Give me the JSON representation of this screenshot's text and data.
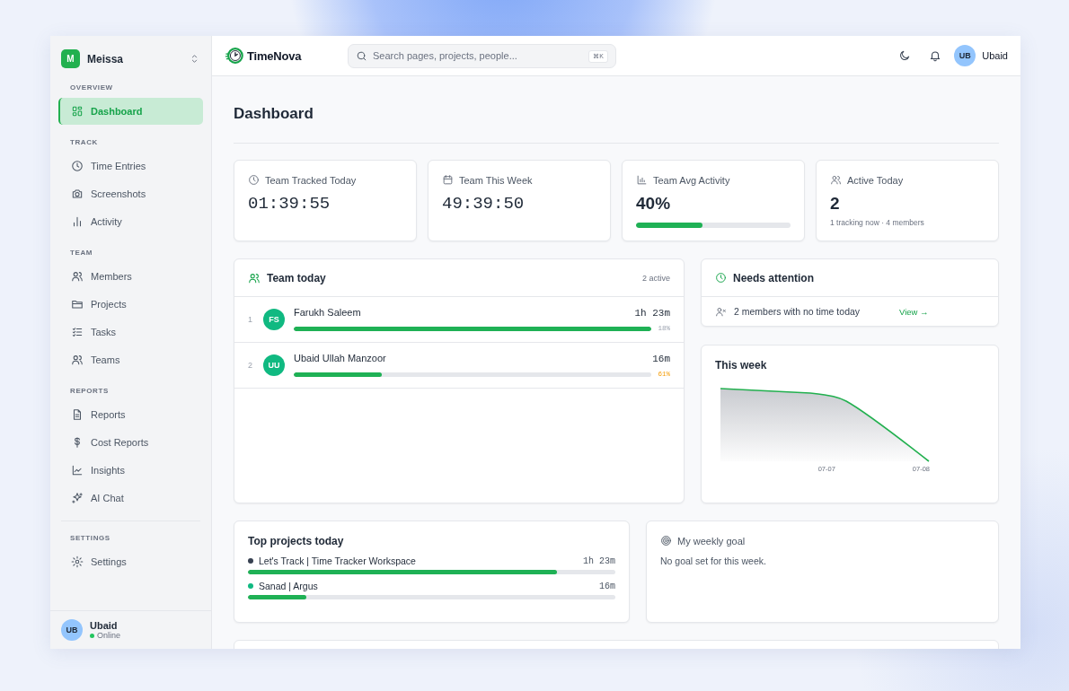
{
  "workspace": {
    "initial": "M",
    "name": "Meissa"
  },
  "sidebar": {
    "sections": [
      {
        "title": "OVERVIEW",
        "items": [
          {
            "label": "Dashboard",
            "selected": true
          }
        ]
      },
      {
        "title": "TRACK",
        "items": [
          {
            "label": "Time Entries",
            "selected": false
          },
          {
            "label": "Screenshots",
            "selected": false
          },
          {
            "label": "Activity",
            "selected": false
          }
        ]
      },
      {
        "title": "TEAM",
        "items": [
          {
            "label": "Members",
            "selected": false
          },
          {
            "label": "Projects",
            "selected": false
          },
          {
            "label": "Tasks",
            "selected": false
          },
          {
            "label": "Teams",
            "selected": false
          }
        ]
      },
      {
        "title": "REPORTS",
        "items": [
          {
            "label": "Reports",
            "selected": false
          },
          {
            "label": "Cost Reports",
            "selected": false
          },
          {
            "label": "Insights",
            "selected": false
          },
          {
            "label": "AI Chat",
            "selected": false
          }
        ]
      },
      {
        "title": "SETTINGS",
        "items": [
          {
            "label": "Settings",
            "selected": false
          }
        ]
      }
    ]
  },
  "sidebar_user": {
    "initials": "UB",
    "name": "Ubaid",
    "status": "Online"
  },
  "topbar": {
    "logo": "TimeNova",
    "search_placeholder": "Search pages, projects, people...",
    "shortcut": "⌘K",
    "user": {
      "initials": "UB",
      "name": "Ubaid"
    }
  },
  "page": {
    "title": "Dashboard"
  },
  "stats": [
    {
      "kind": "time",
      "label": "Team Tracked Today",
      "value": "01:39:55"
    },
    {
      "kind": "time",
      "label": "Team This Week",
      "value": "49:39:50"
    },
    {
      "kind": "progress",
      "label": "Team Avg Activity",
      "value": "40%",
      "level": 0.43
    },
    {
      "kind": "count",
      "label": "Active Today",
      "value": "2",
      "note": "1 tracking now · 4 members"
    }
  ],
  "team_today": {
    "title": "Team today",
    "summary": "2 active",
    "members": [
      {
        "rank": "1",
        "initials": "FS",
        "name": "Farukh Saleem",
        "time": "1h 23m",
        "level": 1.0,
        "percent": "18%",
        "warning": false
      },
      {
        "rank": "2",
        "initials": "UU",
        "name": "Ubaid Ullah Manzoor",
        "time": "16m",
        "level": 0.245,
        "percent": "61%",
        "warning": true
      }
    ]
  },
  "needs_attention": {
    "title": "Needs attention",
    "items": [
      {
        "text": "2 members with no time today",
        "link": "View →"
      }
    ]
  },
  "this_week": {
    "title": "This week",
    "x_labels": [
      "07-07",
      "07-08"
    ]
  },
  "top_projects": {
    "title": "Top projects today",
    "projects": [
      {
        "name": "Let's Track | Time Tracker Workspace",
        "time": "1h 23m",
        "color": "#374151",
        "level": 0.84
      },
      {
        "name": "Sanad | Argus",
        "time": "16m",
        "color": "#10b981",
        "level": 0.16
      }
    ]
  },
  "weekly_goal": {
    "title": "My weekly goal",
    "message": "No goal set for this week."
  }
}
